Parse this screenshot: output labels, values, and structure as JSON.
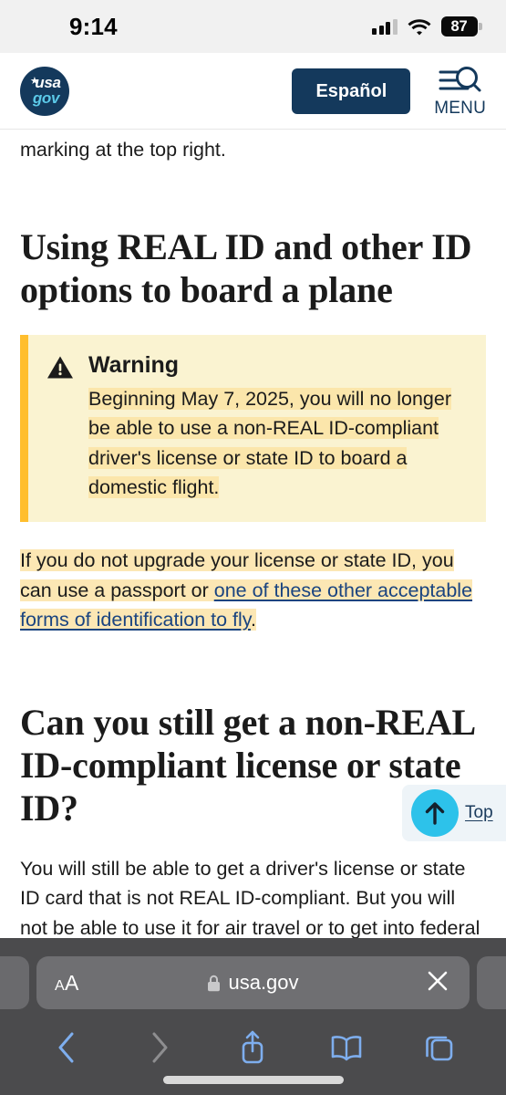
{
  "status_bar": {
    "time": "9:14",
    "battery_percent": "87",
    "signal_icon": "cellular-signal-icon",
    "wifi_icon": "wifi-icon",
    "battery_icon": "battery-icon"
  },
  "site_header": {
    "logo_star": "★",
    "logo_usa": "usa",
    "logo_gov": "gov",
    "espanol_label": "Español",
    "menu_label": "MENU",
    "menu_icon": "hamburger-search-icon",
    "brand_navy": "#14395c",
    "brand_cyan": "#5bc9e8"
  },
  "content": {
    "partial_line": "marking at the top right.",
    "heading_1": "Using REAL ID and other ID options to board a plane",
    "alert": {
      "icon": "warning-triangle-icon",
      "title": "Warning",
      "text": "Beginning May 7, 2025, you will no longer be able to use a non-REAL ID-compliant driver's license or state ID to board a domestic flight.",
      "background": "#faf3d1",
      "border_color": "#ffbe2e",
      "highlight_color": "#fbe6ab"
    },
    "paragraph_1": {
      "before_link": "If you do not upgrade your license or state ID, you can use a passport or ",
      "link_text": "one of these other acceptable forms of identification to fly",
      "after_link": ".",
      "link_color": "#1a4480",
      "highlight_color": "#fce7b4"
    },
    "heading_2": "Can you still get a non-REAL ID-compliant license or state ID?",
    "paragraph_2": "You will still be able to get a driver's license or state ID card that is not REAL ID-compliant. But you will not be able to use it for air travel or to get into federal",
    "back_to_top": {
      "label": "Top",
      "arrow_icon": "arrow-up-icon",
      "circle_color": "#2dc2ea",
      "panel_color": "#eef4f8"
    }
  },
  "safari_toolbar": {
    "text_size_label_small": "A",
    "text_size_label_large": "A",
    "lock_icon": "lock-icon",
    "url": "usa.gov",
    "close_icon": "close-icon",
    "back_icon": "chevron-left-icon",
    "forward_icon": "chevron-right-icon",
    "share_icon": "share-icon",
    "bookmarks_icon": "book-icon",
    "tabs_icon": "tabs-icon",
    "active_color": "#7eaeee",
    "disabled_color": "#8e8e90",
    "bar_color": "#4b4b4d"
  }
}
